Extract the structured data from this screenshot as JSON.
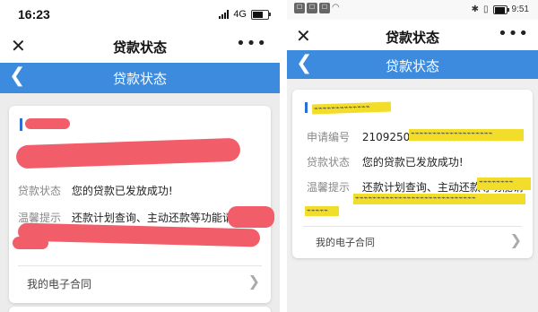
{
  "left": {
    "status": {
      "time": "16:23",
      "network": "4G"
    },
    "titlebar": {
      "title": "贷款状态",
      "close_icon": "close-icon",
      "more_icon": "more-icon"
    },
    "header": {
      "title": "贷款状态"
    },
    "card": {
      "status_label": "贷款状态",
      "status_value": "您的贷款已发放成功!",
      "tip_label": "温馨提示",
      "tip_value": "还款计划查询、主动还款等功能请前",
      "contract_label": "我的电子合同"
    }
  },
  "right": {
    "status": {
      "time": "9:51"
    },
    "titlebar": {
      "title": "贷款状态"
    },
    "header": {
      "title": "贷款状态"
    },
    "card": {
      "app_label": "申请编号",
      "app_value": "2109250129",
      "status_label": "贷款状态",
      "status_value": "您的贷款已发放成功!",
      "tip_label": "温馨提示",
      "tip_value": "还款计划查询、主动还款等功能请",
      "contract_label": "我的电子合同"
    }
  },
  "colors": {
    "accent_blue": "#3d8bde",
    "redaction_red": "#f25d6a",
    "redaction_yellow": "#f2dd2a"
  }
}
